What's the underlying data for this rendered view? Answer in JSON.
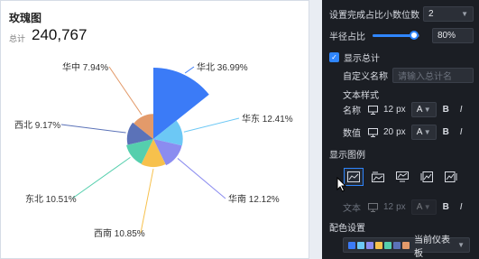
{
  "card": {
    "title": "玫瑰图",
    "total_label": "总计",
    "total_value": "240,767"
  },
  "chart_data": {
    "type": "pie",
    "variant": "rose",
    "series": [
      {
        "name": "华北",
        "pct_label": "华北 36.99%",
        "value": 36.99,
        "color": "#3b7bf7"
      },
      {
        "name": "华东",
        "pct_label": "华东 12.41%",
        "value": 12.41,
        "color": "#6cc8f5"
      },
      {
        "name": "华南",
        "pct_label": "华南 12.12%",
        "value": 12.12,
        "color": "#8b8cf0"
      },
      {
        "name": "西南",
        "pct_label": "西南 10.85%",
        "value": 10.85,
        "color": "#f7c14c"
      },
      {
        "name": "东北",
        "pct_label": "东北 10.51%",
        "value": 10.51,
        "color": "#55cfad"
      },
      {
        "name": "西北",
        "pct_label": "西北 9.17%",
        "value": 9.17,
        "color": "#5b72b8"
      },
      {
        "name": "华中",
        "pct_label": "华中 7.94%",
        "value": 7.94,
        "color": "#e39a6a"
      }
    ]
  },
  "panel": {
    "decimal_label": "设置完成占比小数位数",
    "decimal_value": "2",
    "radius_label": "半径占比",
    "radius_value": "80%",
    "radius_fraction": 0.8,
    "show_total_label": "显示总计",
    "custom_name_label": "自定义名称",
    "custom_name_placeholder": "请输入总计名",
    "text_style_label": "文本样式",
    "name_label": "名称",
    "name_size": "12",
    "value_label": "数值",
    "value_size": "20",
    "unit": "px",
    "font_a": "A",
    "bold": "B",
    "italic": "I",
    "show_legend_label": "显示图例",
    "legend_text_label": "文本",
    "legend_text_size": "12",
    "color_label": "配色设置",
    "color_theme": "当前仪表板",
    "theme_colors": [
      "#3b7bf7",
      "#6cc8f5",
      "#8b8cf0",
      "#f7c14c",
      "#55cfad",
      "#5b72b8",
      "#e39a6a"
    ]
  }
}
